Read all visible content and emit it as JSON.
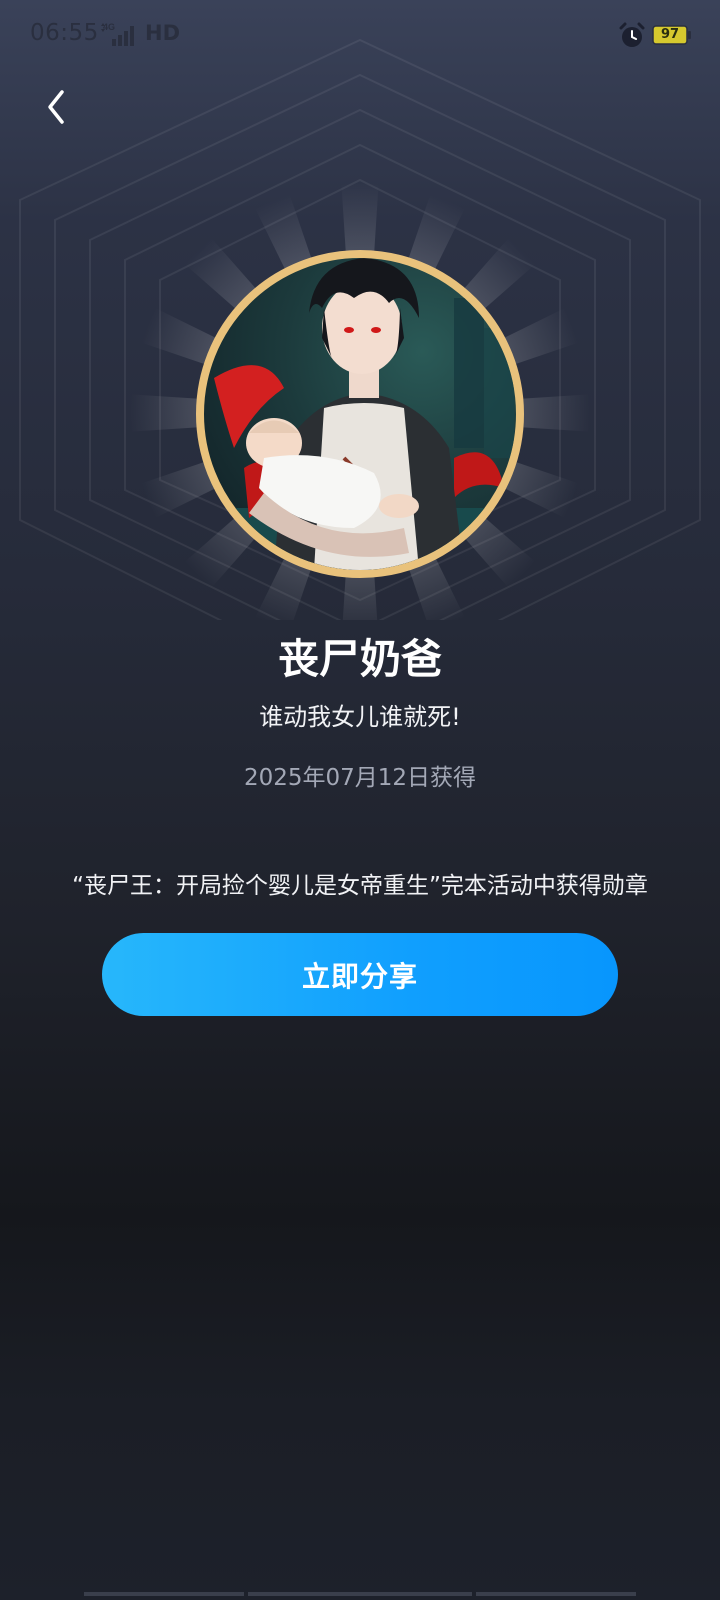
{
  "status_bar": {
    "time": "06:55",
    "network": "HD",
    "network_type": "4G",
    "battery": "97",
    "icons": [
      "signal-icon",
      "alarm-icon",
      "battery-icon"
    ]
  },
  "nav": {
    "back_icon": "chevron-left-icon"
  },
  "badge": {
    "title": "丧尸奶爸",
    "subtitle": "谁动我女儿谁就死!",
    "date": "2025年07月12日获得",
    "description": "“丧尸王：开局捡个婴儿是女帝重生”完本活动中获得勋章",
    "ring_color": "#e9c27c"
  },
  "actions": {
    "share_label": "立即分享",
    "share_color": "#109ffe"
  }
}
